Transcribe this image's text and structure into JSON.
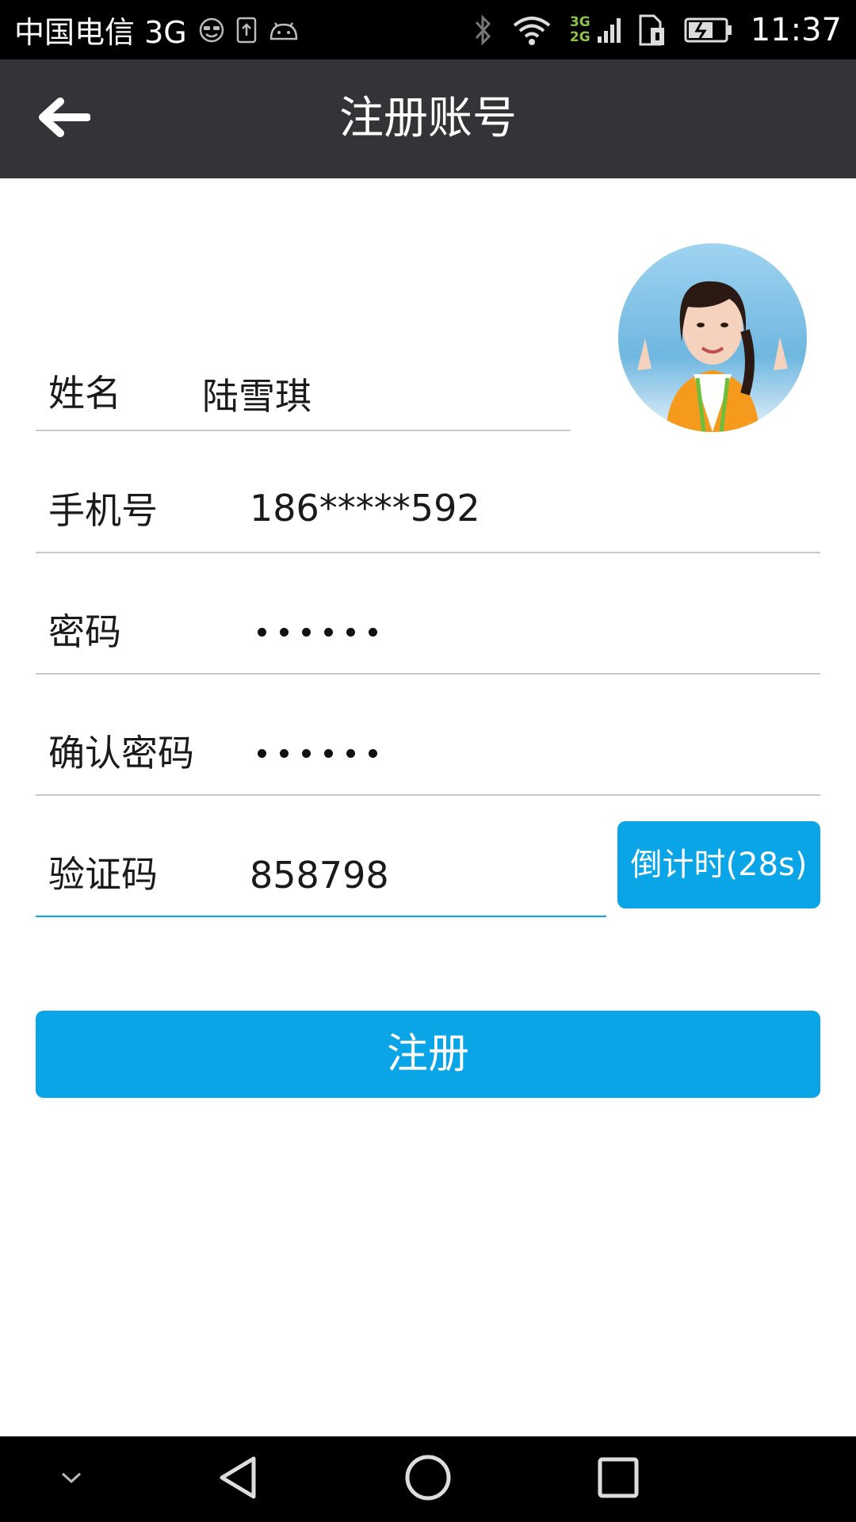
{
  "status_bar": {
    "carrier": "中国电信 3G",
    "network_badge_top": "3G",
    "network_badge_bottom": "2G",
    "time": "11:37"
  },
  "header": {
    "title": "注册账号",
    "back_icon": "arrow-left-icon"
  },
  "form": {
    "name": {
      "label": "姓名",
      "value": "陆雪琪"
    },
    "phone": {
      "label": "手机号",
      "value": "186*****592"
    },
    "password": {
      "label": "密码",
      "value_length": 6
    },
    "confirm_password": {
      "label": "确认密码",
      "value_length": 6
    },
    "verify_code": {
      "label": "验证码",
      "value": "858798"
    },
    "countdown_label": "倒计时(28s)",
    "submit_label": "注册"
  },
  "nav_bar": {
    "icons": [
      "chevron-down-icon",
      "back-triangle-icon",
      "home-circle-icon",
      "recents-square-icon"
    ]
  },
  "colors": {
    "accent": "#0aa5e6",
    "title_bar": "#333338",
    "status_bar": "#000000"
  }
}
